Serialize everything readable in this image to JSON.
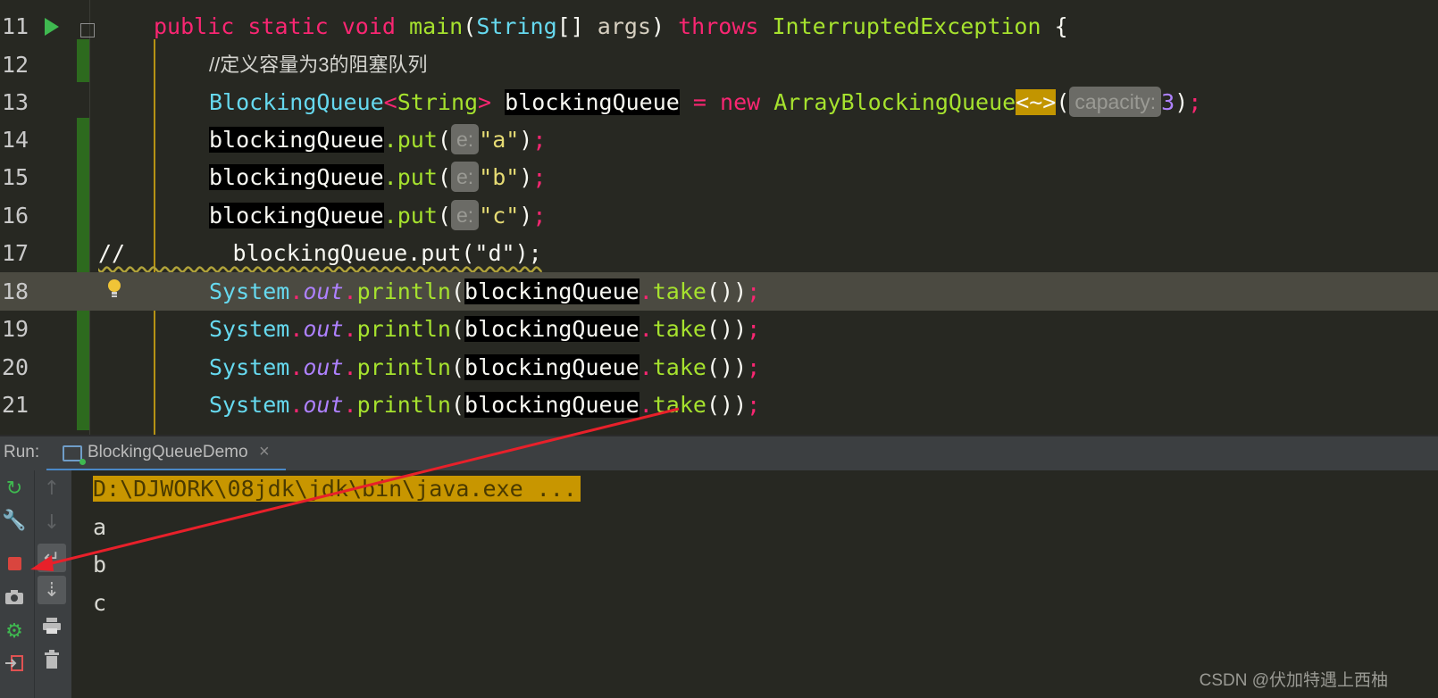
{
  "editor": {
    "lines": [
      {
        "num": "11"
      },
      {
        "num": "12"
      },
      {
        "num": "13"
      },
      {
        "num": "14"
      },
      {
        "num": "15"
      },
      {
        "num": "16"
      },
      {
        "num": "17"
      },
      {
        "num": "18"
      },
      {
        "num": "19"
      },
      {
        "num": "20"
      },
      {
        "num": "21"
      }
    ],
    "tokens": {
      "public": "public",
      "static": "static",
      "void": "void",
      "main": "main",
      "string_type": "String",
      "brackets": "[]",
      "args": "args",
      "throws": "throws",
      "exception": "InterruptedException",
      "open_brace": "{",
      "comment_cn": "//定义容量为3的阻塞队列",
      "blocking_queue_type": "BlockingQueue",
      "lt": "<",
      "gt": ">",
      "var": "blockingQueue",
      "assign": "=",
      "new": "new",
      "array_queue": "ArrayBlockingQueue",
      "diamond": "<~>",
      "capacity_hint": "capacity:",
      "capacity_value": "3",
      "dot_put": ".put",
      "e_hint": "e:",
      "str_a": "\"a\"",
      "str_b": "\"b\"",
      "str_c": "\"c\"",
      "commented_line": "//        blockingQueue.put(\"d\");",
      "system": "System",
      "out": "out",
      "println": "println",
      "take": "take",
      "semicolon": ";",
      "open_paren": "(",
      "close_paren": ")",
      "close_paren2": "())",
      "dot": "."
    }
  },
  "run_panel": {
    "label": "Run:",
    "tab_label": "BlockingQueueDemo",
    "tab_close": "×",
    "output": [
      "D:\\DJWORK\\08jdk\\jdk\\bin\\java.exe ...",
      "a",
      "b",
      "c"
    ],
    "toolbar_icons": [
      "rerun-icon",
      "settings-wrench-icon",
      "stop-icon",
      "camera-icon",
      "debug-icon",
      "exit-icon",
      "up-arrow-icon",
      "down-arrow-icon",
      "soft-wrap-icon",
      "scroll-to-end-icon",
      "print-icon",
      "trash-icon"
    ]
  },
  "watermark": "CSDN @伏加特遇上西柚",
  "colors": {
    "editor_bg": "#272822",
    "keyword": "#f92672",
    "function": "#a6e22e",
    "type": "#66d9ef",
    "string": "#e6db74",
    "number": "#ae81ff",
    "annotation_arrow": "#e8202a",
    "stop_red": "#d9453e"
  }
}
